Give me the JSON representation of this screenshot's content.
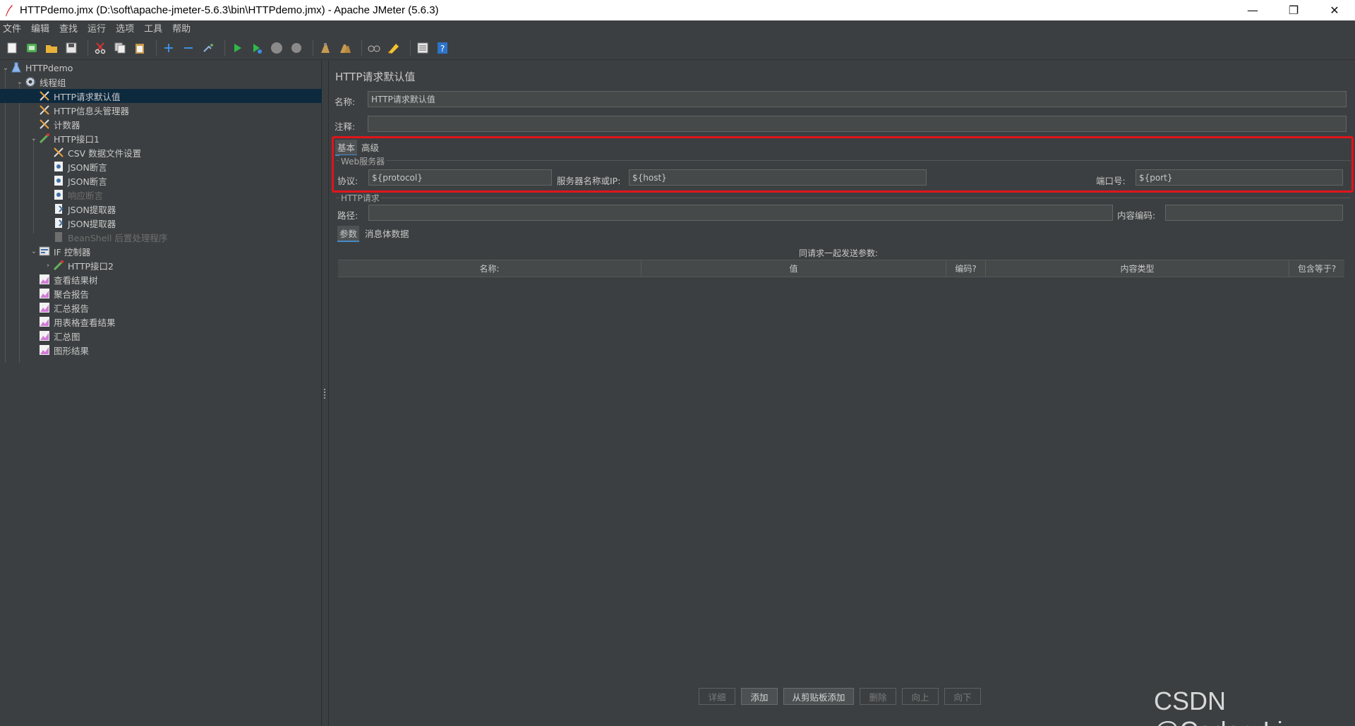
{
  "window": {
    "title": "HTTPdemo.jmx (D:\\soft\\apache-jmeter-5.6.3\\bin\\HTTPdemo.jmx) - Apache JMeter (5.6.3)",
    "minimize": "—",
    "maximize": "❐",
    "close": "✕"
  },
  "menu": [
    "文件",
    "编辑",
    "查找",
    "运行",
    "选项",
    "工具",
    "帮助"
  ],
  "toolbar": {
    "icons": [
      "new-icon",
      "templates-icon",
      "open-icon",
      "save-icon",
      "cut-icon",
      "copy-icon",
      "paste-icon",
      "expand-icon",
      "collapse-icon",
      "toggle-icon",
      "start-icon",
      "start-no-pause-icon",
      "stop-icon",
      "shutdown-icon",
      "clear-icon",
      "clear-all-icon",
      "search-icon",
      "reset-search-icon",
      "function-helper-icon",
      "help-icon"
    ]
  },
  "tree": {
    "items": [
      {
        "label": "HTTPdemo",
        "icon": "test-plan-icon",
        "arrow": "⌄"
      },
      {
        "label": "线程组",
        "icon": "gear-icon",
        "arrow": "⌄"
      },
      {
        "label": "HTTP请求默认值",
        "icon": "wrench-icon",
        "arrow": ""
      },
      {
        "label": "HTTP信息头管理器",
        "icon": "wrench-icon",
        "arrow": ""
      },
      {
        "label": "计数器",
        "icon": "wrench-icon",
        "arrow": ""
      },
      {
        "label": "HTTP接口1",
        "icon": "pipette-icon",
        "arrow": "⌄"
      },
      {
        "label": "CSV 数据文件设置",
        "icon": "wrench-icon",
        "arrow": ""
      },
      {
        "label": "JSON断言",
        "icon": "assertion-icon",
        "arrow": ""
      },
      {
        "label": "JSON断言",
        "icon": "assertion-icon",
        "arrow": ""
      },
      {
        "label": "响应断言",
        "icon": "assertion-icon",
        "arrow": ""
      },
      {
        "label": "JSON提取器",
        "icon": "extractor-icon",
        "arrow": ""
      },
      {
        "label": "JSON提取器",
        "icon": "extractor-icon",
        "arrow": ""
      },
      {
        "label": "BeanShell 后置处理程序",
        "icon": "postprocessor-icon",
        "arrow": ""
      },
      {
        "label": "IF 控制器",
        "icon": "controller-icon",
        "arrow": "⌄"
      },
      {
        "label": "HTTP接口2",
        "icon": "pipette-icon",
        "arrow": "›"
      },
      {
        "label": "查看结果树",
        "icon": "chart-icon",
        "arrow": ""
      },
      {
        "label": "聚合报告",
        "icon": "chart-icon",
        "arrow": ""
      },
      {
        "label": "汇总报告",
        "icon": "chart-icon",
        "arrow": ""
      },
      {
        "label": "用表格查看结果",
        "icon": "chart-icon",
        "arrow": ""
      },
      {
        "label": "汇总图",
        "icon": "chart-icon",
        "arrow": ""
      },
      {
        "label": "图形结果",
        "icon": "chart-icon",
        "arrow": ""
      }
    ]
  },
  "panel": {
    "title": "HTTP请求默认值",
    "name_label": "名称:",
    "name_value": "HTTP请求默认值",
    "comment_label": "注释:",
    "comment_value": "",
    "tabs": {
      "basic": "基本",
      "advanced": "高级"
    },
    "web_server": {
      "legend": "Web服务器",
      "protocol_label": "协议:",
      "protocol_value": "${protocol}",
      "host_label": "服务器名称或IP:",
      "host_value": "${host}",
      "port_label": "端口号:",
      "port_value": "${port}"
    },
    "http_request": {
      "legend": "HTTP请求",
      "path_label": "路径:",
      "path_value": "",
      "encoding_label": "内容编码:",
      "encoding_value": ""
    },
    "sub_tabs": {
      "params": "参数",
      "body": "消息体数据"
    },
    "table": {
      "caption": "同请求一起发送参数:",
      "headers": [
        "名称:",
        "值",
        "编码?",
        "内容类型",
        "包含等于?"
      ]
    },
    "buttons": [
      "详细",
      "添加",
      "从剪贴板添加",
      "删除",
      "向上",
      "向下"
    ]
  },
  "watermark": "CSDN @Coder_Li"
}
